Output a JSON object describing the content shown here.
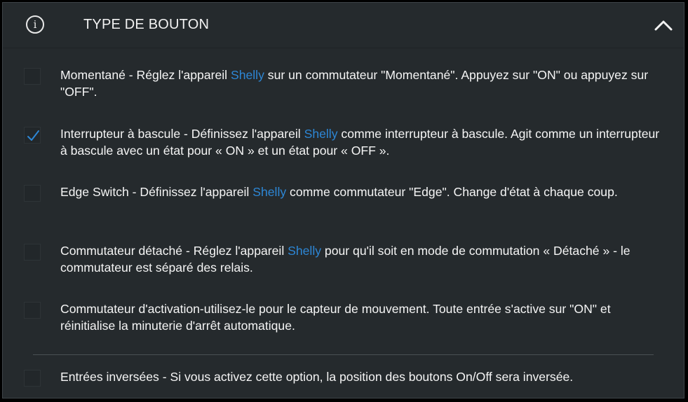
{
  "header": {
    "title": "TYPE DE BOUTON",
    "info_icon": "info-circle-icon",
    "collapse_icon": "chevron-up-icon"
  },
  "options": [
    {
      "checked": false,
      "before": "Momentané - Réglez l'appareil ",
      "link": "Shelly",
      "after": " sur un commutateur \"Momentané\". Appuyez sur \"ON\" ou appuyez sur \"OFF\"."
    },
    {
      "checked": true,
      "before": "Interrupteur à bascule - Définissez l'appareil ",
      "link": "Shelly",
      "after": " comme interrupteur à bascule. Agit comme un interrupteur à bascule avec un état pour « ON » et un état pour « OFF »."
    },
    {
      "checked": false,
      "before": "Edge Switch - Définissez l'appareil ",
      "link": "Shelly",
      "after": " comme commutateur \"Edge\". Change d'état à chaque coup."
    },
    {
      "checked": false,
      "before": "Commutateur détaché - Réglez l'appareil ",
      "link": "Shelly",
      "after": " pour qu'il soit en mode de commutation « Détaché » - le commutateur est séparé des relais."
    },
    {
      "checked": false,
      "before": "Commutateur d'activation-utilisez-le pour le capteur de mouvement. Toute entrée s'active sur \"ON\" et réinitialise la minuterie d'arrêt automatique.",
      "link": "",
      "after": ""
    }
  ],
  "inverted": {
    "checked": false,
    "label": "Entrées inversées - Si vous activez cette option, la position des boutons On/Off sera inversée."
  },
  "colors": {
    "panel_bg": "#252a2d",
    "link": "#2d87d6",
    "check": "#2d87d6",
    "text": "#f5f5f5"
  }
}
